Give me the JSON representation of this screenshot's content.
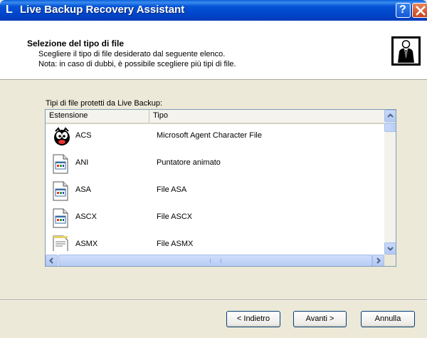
{
  "window": {
    "title": "Live Backup Recovery Assistant",
    "help_label": "?"
  },
  "header": {
    "title": "Selezione del tipo di file",
    "subtitle_line1": "Scegliere il tipo di file desiderato dal seguente elenco.",
    "subtitle_line2": "Nota: in caso di dubbi, è possibile scegliere più tipi di file."
  },
  "list": {
    "label": "Tipi di file protetti da Live Backup:",
    "columns": [
      "Estensione",
      "Tipo"
    ],
    "rows": [
      {
        "ext": "ACS",
        "tipo": "Microsoft Agent Character File",
        "icon": "agent-character-icon"
      },
      {
        "ext": "ANI",
        "tipo": "Puntatore animato",
        "icon": "generic-file-icon"
      },
      {
        "ext": "ASA",
        "tipo": "File ASA",
        "icon": "generic-file-icon"
      },
      {
        "ext": "ASCX",
        "tipo": "File ASCX",
        "icon": "generic-file-icon"
      },
      {
        "ext": "ASMX",
        "tipo": "File ASMX",
        "icon": "notepad-file-icon"
      }
    ]
  },
  "buttons": {
    "back": "< Indietro",
    "next": "Avanti >",
    "cancel": "Annulla"
  }
}
